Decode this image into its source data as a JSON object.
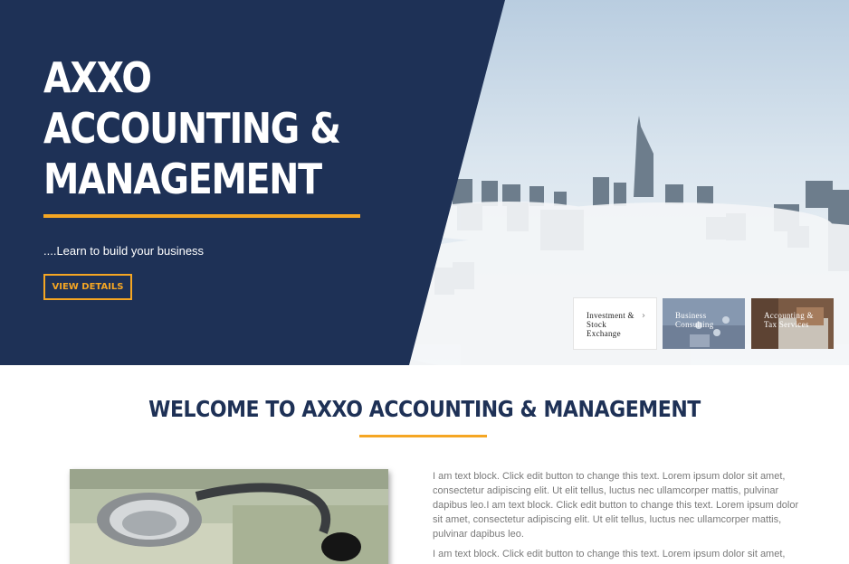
{
  "hero": {
    "title_lines": [
      "AXXO",
      "ACCOUNTING &",
      "MANAGEMENT"
    ],
    "tagline": "....Learn to build your business",
    "button_label": "VIEW DETAILS"
  },
  "cards": [
    {
      "label": "Investment & Stock Exchange",
      "arrow": "›"
    },
    {
      "label": "Business Consulting"
    },
    {
      "label": "Accounting & Tax Services"
    }
  ],
  "welcome": {
    "title": "WELCOME TO AXXO ACCOUNTING & MANAGEMENT",
    "paragraphs": [
      "I am text block. Click edit button to change this text. Lorem ipsum dolor sit amet, consectetur adipiscing elit. Ut elit tellus, luctus nec ullamcorper mattis, pulvinar dapibus leo.I am text block. Click edit button to change this text. Lorem ipsum dolor sit amet, consectetur adipiscing elit. Ut elit tellus, luctus nec ullamcorper mattis, pulvinar dapibus leo.",
      "I am text block. Click edit button to change this text. Lorem ipsum dolor sit amet,"
    ]
  },
  "colors": {
    "navy": "#1e3156",
    "accent": "#f5a623",
    "body_text": "#7a7a7a"
  }
}
